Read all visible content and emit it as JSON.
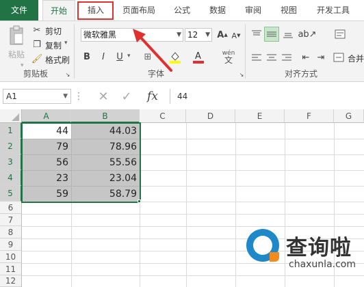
{
  "tabs": {
    "file": "文件",
    "home": "开始",
    "insert": "插入",
    "page_layout": "页面布局",
    "formulas": "公式",
    "data": "数据",
    "review": "审阅",
    "view": "视图",
    "developer": "开发工具"
  },
  "ribbon": {
    "clipboard": {
      "paste": "粘贴",
      "cut": "剪切",
      "copy": "复制",
      "format_painter": "格式刷",
      "group_label": "剪贴板"
    },
    "font": {
      "font_name": "微软雅黑",
      "font_size": "12",
      "bold": "B",
      "italic": "I",
      "underline": "U",
      "group_label": "字体",
      "phonetic": "wén"
    },
    "alignment": {
      "group_label": "对齐方式",
      "merge": "合并"
    }
  },
  "formula_bar": {
    "name_box": "A1",
    "fx": "fx",
    "value": "44"
  },
  "grid": {
    "columns": [
      "A",
      "B",
      "C",
      "D",
      "E",
      "F",
      "G"
    ],
    "rows": [
      "1",
      "2",
      "3",
      "4",
      "5",
      "6",
      "7",
      "8",
      "9",
      "10",
      "11",
      "12"
    ],
    "col_a": [
      "44",
      "79",
      "56",
      "23",
      "59"
    ],
    "col_b": [
      "44.03",
      "78.96",
      "55.56",
      "23.04",
      "58.79"
    ]
  },
  "watermark": {
    "cn": "查询啦",
    "en": "chaxunla.com"
  },
  "colors": {
    "excel_green": "#217346",
    "annotation_red": "#e03030",
    "selection_fill": "#c6c6c6"
  }
}
